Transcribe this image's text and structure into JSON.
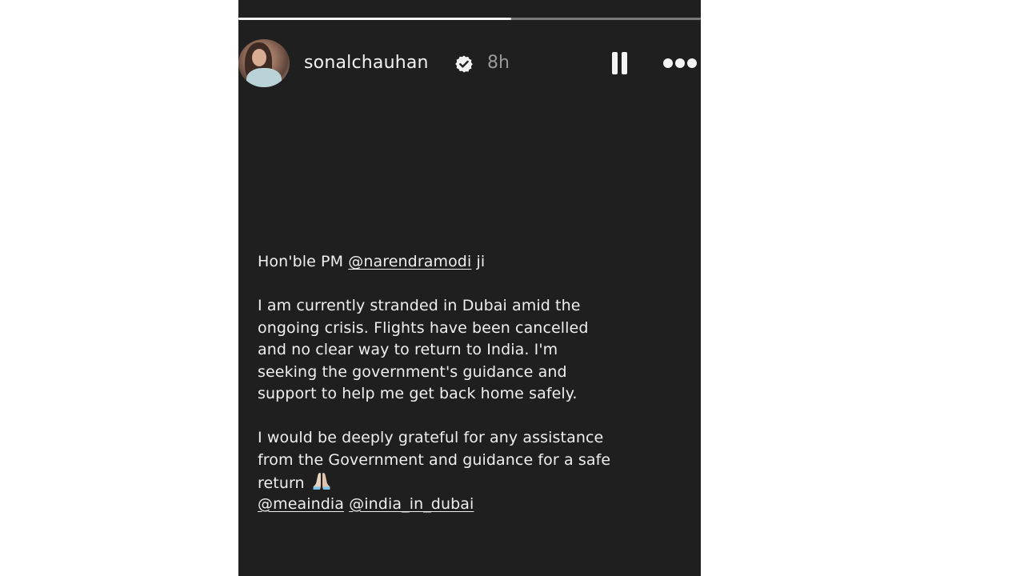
{
  "story": {
    "progress_fraction": 0.59,
    "header": {
      "username": "sonalchauhan",
      "time": "8h",
      "icons": {
        "avatar": "profile-avatar",
        "verified": "verified-badge-icon",
        "pause": "pause-icon",
        "more": "more-icon"
      }
    },
    "text": {
      "line1_prefix": "Hon'ble PM ",
      "line1_mention": "@narendramodi",
      "line1_suffix": " ji",
      "paragraph1": [
        "I am currently stranded in Dubai amid the",
        "ongoing crisis. Flights have been cancelled",
        "and no clear way  to return to India. I'm",
        "seeking the government's guidance and",
        "support to help me get back home safely."
      ],
      "paragraph2": [
        "I would be deeply grateful for any assistance",
        "from the Government and guidance for a safe"
      ],
      "return_word": "return",
      "mentions": [
        "@meaindia",
        "@india_in_dubai"
      ]
    }
  }
}
